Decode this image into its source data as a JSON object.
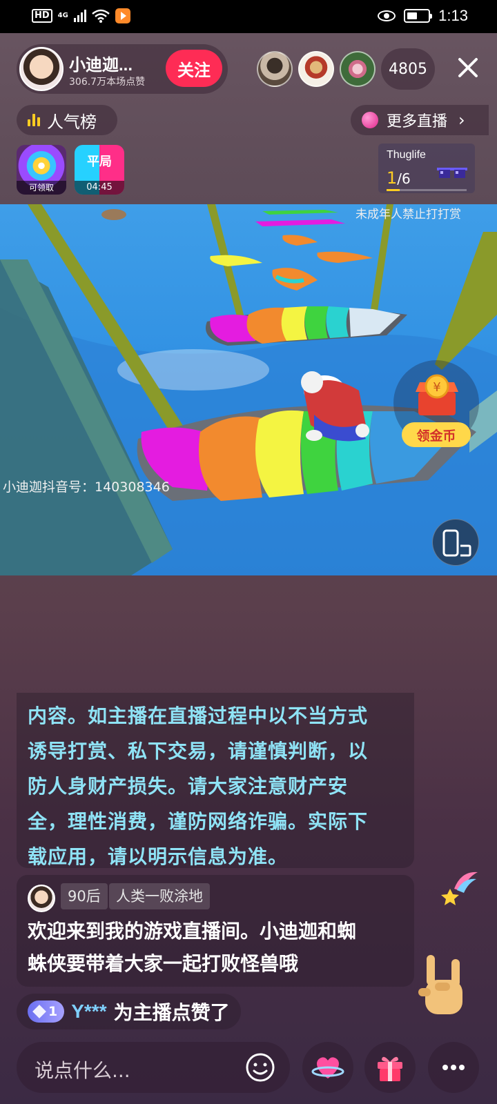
{
  "status_bar": {
    "hd": "HD",
    "network": "4G",
    "time": "1:13"
  },
  "host": {
    "name": "小迪迦...",
    "likes": "306.7万本场点赞",
    "follow_label": "关注"
  },
  "viewers": {
    "count": "4805"
  },
  "ranking": {
    "label": "人气榜"
  },
  "more_live": {
    "label": "更多直播"
  },
  "badges": {
    "reward_label": "可领取",
    "match_title": "平局",
    "match_time": "04:45"
  },
  "task": {
    "name": "Thuglife",
    "current": "1",
    "total": "/6",
    "progress": 0.167
  },
  "video": {
    "warning": "未成年人禁止打打赏",
    "watermark": "小迪迦抖音号：140308346"
  },
  "coin": {
    "label": "领金币"
  },
  "chat": {
    "notice_lines": [
      "内容。如主播在直播过程中以不当方式",
      "诱导打赏、私下交易，请谨慎判断，以",
      "防人身财产损失。请大家注意财产安",
      "全，理性消费，谨防网络诈骗。实际下",
      "载应用，请以明示信息为准。"
    ],
    "message": {
      "tag1": "90后",
      "tag2": "人类一败涂地",
      "lines": [
        "欢迎来到我的游戏直播间。小迪迦和蜘",
        "蛛侠要带着大家一起打败怪兽哦"
      ]
    },
    "like_event": {
      "level": "1",
      "user": "Y***",
      "text": "为主播点赞了"
    }
  },
  "input": {
    "placeholder": "说点什么..."
  },
  "colors": {
    "follow": "#fe2c55",
    "notice_text": "#8fe3f6",
    "like_user": "#7fd0ff",
    "coin_label_bg": "#ffd84a"
  }
}
